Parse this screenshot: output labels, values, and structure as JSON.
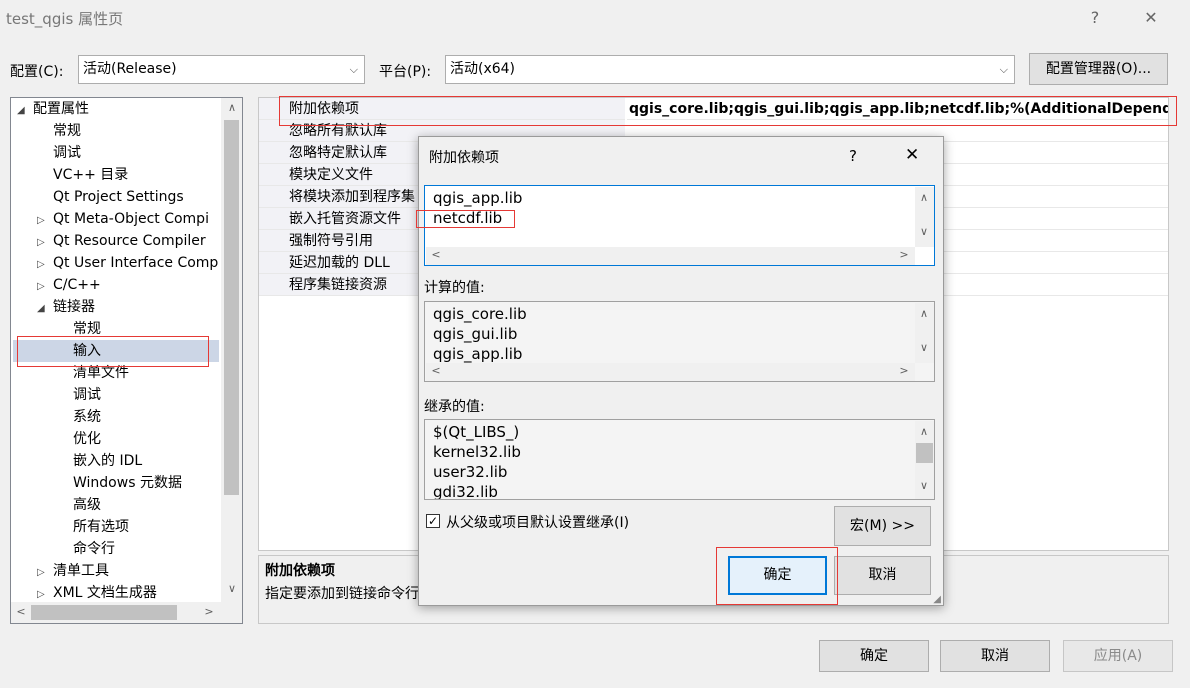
{
  "window": {
    "title": "test_qgis 属性页",
    "help": "?",
    "close": "✕"
  },
  "config": {
    "label": "配置(C):",
    "value": "活动(Release)",
    "platform_label": "平台(P):",
    "platform_value": "活动(x64)",
    "manager_button": "配置管理器(O)..."
  },
  "tree": {
    "items": [
      {
        "label": "配置属性",
        "exp": "◢"
      },
      {
        "label": "常规",
        "exp": ""
      },
      {
        "label": "调试",
        "exp": ""
      },
      {
        "label": "VC++ 目录",
        "exp": ""
      },
      {
        "label": "Qt Project Settings",
        "exp": ""
      },
      {
        "label": "Qt Meta-Object Compi",
        "exp": "▷"
      },
      {
        "label": "Qt Resource Compiler",
        "exp": "▷"
      },
      {
        "label": "Qt User Interface Comp",
        "exp": "▷"
      },
      {
        "label": "C/C++",
        "exp": "▷"
      },
      {
        "label": "链接器",
        "exp": "◢"
      },
      {
        "label": "常规",
        "exp": ""
      },
      {
        "label": "输入",
        "exp": ""
      },
      {
        "label": "清单文件",
        "exp": ""
      },
      {
        "label": "调试",
        "exp": ""
      },
      {
        "label": "系统",
        "exp": ""
      },
      {
        "label": "优化",
        "exp": ""
      },
      {
        "label": "嵌入的 IDL",
        "exp": ""
      },
      {
        "label": "Windows 元数据",
        "exp": ""
      },
      {
        "label": "高级",
        "exp": ""
      },
      {
        "label": "所有选项",
        "exp": ""
      },
      {
        "label": "命令行",
        "exp": ""
      },
      {
        "label": "清单工具",
        "exp": "▷"
      },
      {
        "label": "XML 文档生成器",
        "exp": "▷"
      }
    ]
  },
  "grid": {
    "rows": [
      {
        "name": "附加依赖项",
        "value": "qgis_core.lib;qgis_gui.lib;qgis_app.lib;netcdf.lib;%(AdditionalDependenci"
      },
      {
        "name": "忽略所有默认库",
        "value": ""
      },
      {
        "name": "忽略特定默认库",
        "value": ""
      },
      {
        "name": "模块定义文件",
        "value": ""
      },
      {
        "name": "将模块添加到程序集",
        "value": ""
      },
      {
        "name": "嵌入托管资源文件",
        "value": ""
      },
      {
        "name": "强制符号引用",
        "value": ""
      },
      {
        "name": "延迟加载的 DLL",
        "value": ""
      },
      {
        "name": "程序集链接资源",
        "value": ""
      }
    ]
  },
  "description": {
    "title": "附加依赖项",
    "text": "指定要添加到链接命令行"
  },
  "dialog": {
    "title": "附加依赖项",
    "help": "?",
    "close": "✕",
    "edit_lines": [
      "qgis_app.lib",
      "netcdf.lib"
    ],
    "computed_label": "计算的值:",
    "computed_lines": [
      "qgis_core.lib",
      "qgis_gui.lib",
      "qgis_app.lib"
    ],
    "inherited_label": "继承的值:",
    "inherited_lines": [
      "$(Qt_LIBS_)",
      "kernel32.lib",
      "user32.lib",
      "gdi32.lib"
    ],
    "inherit_checkbox": "从父级或项目默认设置继承(I)",
    "macro_button": "宏(M) >>",
    "ok": "确定",
    "cancel": "取消"
  },
  "footer": {
    "ok": "确定",
    "cancel": "取消",
    "apply": "应用(A)"
  }
}
